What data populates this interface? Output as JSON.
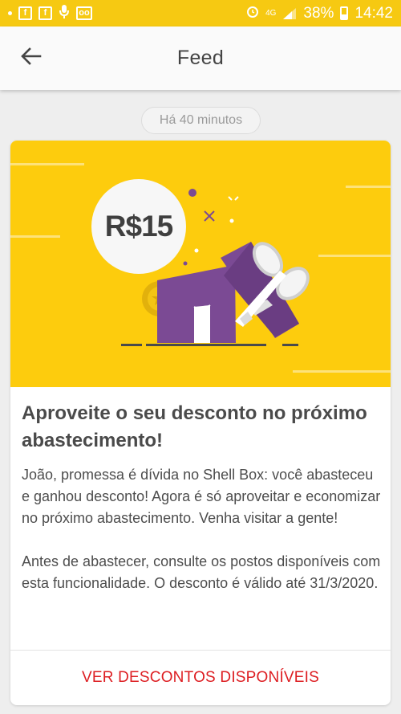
{
  "status_bar": {
    "battery": "38%",
    "time": "14:42",
    "network": "4G",
    "icons": [
      "facebook-icon",
      "facebook-icon",
      "microphone-icon",
      "voicemail-icon",
      "alarm-icon",
      "signal-icon",
      "battery-icon"
    ]
  },
  "app_bar": {
    "title": "Feed",
    "back_icon": "arrow-left-icon"
  },
  "feed": {
    "timestamp": "Há 40 minutos",
    "card": {
      "badge_amount": "R$15",
      "title": "Aproveite o seu desconto no próximo abastecimento!",
      "paragraph1": "João, promessa é dívida no Shell Box: você abasteceu e ganhou desconto! Agora é só aproveitar e economizar no próximo abastecimento. Venha visitar a gente!",
      "paragraph2": "Antes de abastecer, consulte os postos disponíveis com esta funcionalidade. O desconto é válido até 31/3/2020.",
      "cta_label": "VER DESCONTOS DISPONÍVEIS"
    }
  },
  "colors": {
    "status_bar": "#f6c912",
    "hero_background": "#fdcc0d",
    "gift_box": "#7b4a94",
    "cta_text": "#dd1d21"
  }
}
